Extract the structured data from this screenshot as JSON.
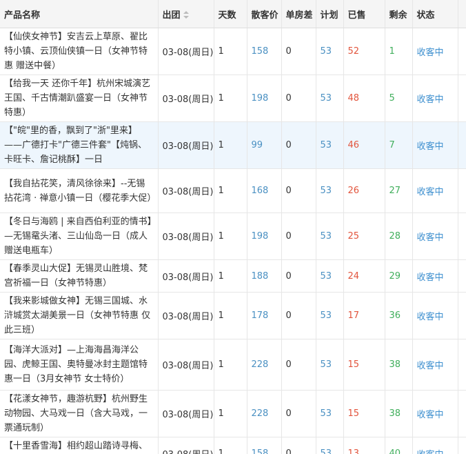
{
  "table": {
    "headers": {
      "name": "产品名称",
      "date": "出团",
      "days": "天数",
      "price": "散客价",
      "single": "单房差",
      "plan": "计划",
      "sold": "已售",
      "remain": "剩余",
      "status": "状态"
    },
    "rows": [
      {
        "name": "【仙侠女神节】安吉云上草原、翟比特小镇、云顶仙侠镇一日（女神节特惠 赠送中餐）",
        "date": "03-08(周日)",
        "days": "1",
        "price": "158",
        "single": "0",
        "plan": "53",
        "sold": "52",
        "remain": "1",
        "status": "收客中"
      },
      {
        "name": "【给我一天 还你千年】杭州宋城演艺王国、千古情潮趴盛宴一日（女神节特惠）",
        "date": "03-08(周日)",
        "days": "1",
        "price": "198",
        "single": "0",
        "plan": "53",
        "sold": "48",
        "remain": "5",
        "status": "收客中"
      },
      {
        "name": "【\"皖\"里的香，飘到了\"浙\"里来】——广德打卡\"广德三件套\"【炖锅、卡旺卡、詹记桃酥】一日",
        "date": "03-08(周日)",
        "days": "1",
        "price": "99",
        "single": "0",
        "plan": "53",
        "sold": "46",
        "remain": "7",
        "status": "收客中"
      },
      {
        "name": "【我自拈花笑，清风徐徐来】--无锡拈花湾 · 禅意小镇一日（樱花季大促）",
        "date": "03-08(周日)",
        "days": "1",
        "price": "168",
        "single": "0",
        "plan": "53",
        "sold": "26",
        "remain": "27",
        "status": "收客中"
      },
      {
        "name": "【冬日与海鸥 | 来自西伯利亚的情书】—无锡鼋头渚、三山仙岛一日（成人赠送电瓶车）",
        "date": "03-08(周日)",
        "days": "1",
        "price": "198",
        "single": "0",
        "plan": "53",
        "sold": "25",
        "remain": "28",
        "status": "收客中"
      },
      {
        "name": "【春季灵山大促】无锡灵山胜境、梵宫祈福一日（女神节特惠）",
        "date": "03-08(周日)",
        "days": "1",
        "price": "188",
        "single": "0",
        "plan": "53",
        "sold": "24",
        "remain": "29",
        "status": "收客中"
      },
      {
        "name": "【我来影城做女神】无锡三国城、水浒城赏太湖美景一日（女神节特惠 仅此三班）",
        "date": "03-08(周日)",
        "days": "1",
        "price": "178",
        "single": "0",
        "plan": "53",
        "sold": "17",
        "remain": "36",
        "status": "收客中"
      },
      {
        "name": "【海洋大派对】—上海海昌海洋公园、虎鲸王国、奥特曼冰封主题馆特惠一日（3月女神节 女士特价）",
        "date": "03-08(周日)",
        "days": "1",
        "price": "228",
        "single": "0",
        "plan": "53",
        "sold": "15",
        "remain": "38",
        "status": "收客中"
      },
      {
        "name": "【花漾女神节，趣游杭野】杭州野生动物园、大马戏一日（含大马戏，一票通玩制）",
        "date": "03-08(周日)",
        "days": "1",
        "price": "228",
        "single": "0",
        "plan": "53",
        "sold": "15",
        "remain": "38",
        "status": "收客中"
      },
      {
        "name": "【十里香雪海】相约超山踏诗寻梅、塘栖古镇老街美食一日",
        "date": "03-08(周日)",
        "days": "1",
        "price": "158",
        "single": "0",
        "plan": "53",
        "sold": "13",
        "remain": "40",
        "status": "收客中"
      }
    ]
  },
  "colors": {
    "header_bg": "#f5f5f5",
    "highlight_row_bg": "#eef6fd",
    "blue_value": "#4a90c2",
    "sold_red": "#e2543c",
    "remain_green": "#3fae5b",
    "status_link": "#3d8fcf"
  },
  "icons": {
    "sort": "sort-icon"
  }
}
